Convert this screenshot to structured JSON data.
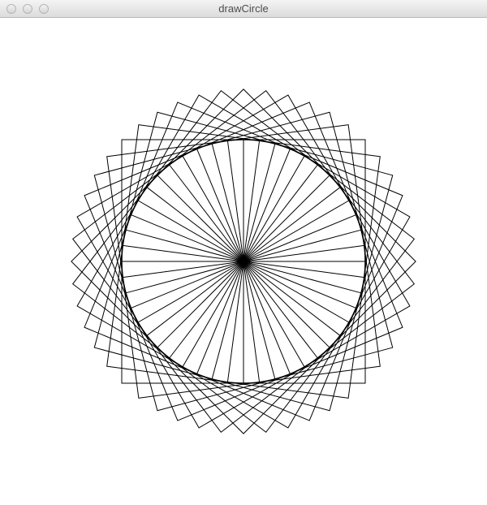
{
  "window": {
    "title": "drawCircle"
  },
  "drawing": {
    "background_color": "#ffffff",
    "stroke_color": "#000000",
    "radial_line_count": 48,
    "rotated_square_count": 12,
    "includes_circle": true
  }
}
